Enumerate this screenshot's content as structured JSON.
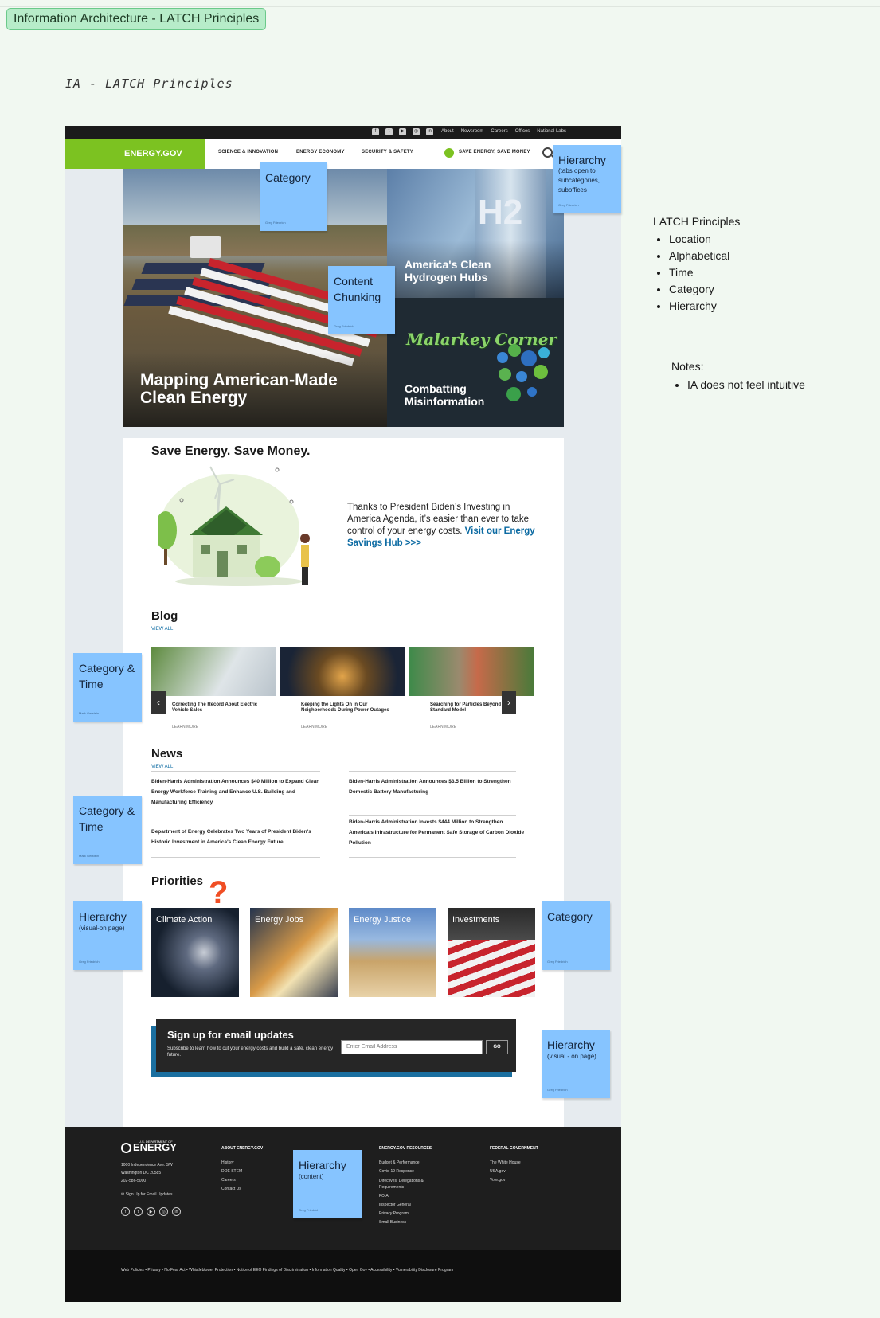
{
  "frame_title": "Information Architecture - LATCH Principles",
  "handwritten_title": "IA - LATCH Principles",
  "site": {
    "utility_links": [
      "About",
      "Newsroom",
      "Careers",
      "Offices",
      "National Labs"
    ],
    "social_icons": [
      "facebook-icon",
      "twitter-icon",
      "youtube-icon",
      "instagram-icon",
      "linkedin-icon"
    ],
    "logo": "ENERGY.GOV",
    "nav": [
      "SCIENCE & INNOVATION",
      "ENERGY ECONOMY",
      "SECURITY & SAFETY",
      "SAVE ENERGY, SAVE MONEY"
    ],
    "brand_green": "#7cc221",
    "hero": {
      "main": "Mapping American-Made Clean Energy",
      "hydrogen": "America's Clean Hydrogen Hubs",
      "h2_graphic": "H2",
      "malarkey_logo": "Malarkey Corner",
      "malarkey": "Combatting Misinformation"
    },
    "save": {
      "title": "Save Energy. Save Money.",
      "text": "Thanks to President Biden’s Investing in America Agenda, it’s easier than ever to take control of your energy costs.",
      "link": "Visit our Energy Savings Hub >>>"
    },
    "blog": {
      "title": "Blog",
      "view_all": "VIEW ALL",
      "more": "LEARN MORE",
      "cards": [
        "Correcting The Record About Electric Vehicle Sales",
        "Keeping the Lights On in Our Neighborhoods During Power Outages",
        "Searching for Particles Beyond the Standard Model"
      ]
    },
    "news": {
      "title": "News",
      "view_all": "VIEW ALL",
      "items": [
        "Biden-Harris Administration Announces $40 Million to Expand Clean Energy Workforce Training and Enhance U.S. Building and Manufacturing Efficiency",
        "Biden-Harris Administration Announces $3.5 Billion to Strengthen Domestic Battery Manufacturing",
        "Department of Energy Celebrates Two Years of President Biden's Historic Investment in America's Clean Energy Future",
        "Biden-Harris Administration Invests $444 Million to Strengthen America's Infrastructure for Permanent Safe Storage of Carbon Dioxide Pollution"
      ]
    },
    "priorities": {
      "title": "Priorities",
      "items": [
        "Climate Action",
        "Energy Jobs",
        "Energy Justice",
        "Investments"
      ]
    },
    "signup": {
      "title": "Sign up for email updates",
      "sub": "Subscribe to learn how to cut your energy costs and build a safe, clean energy future.",
      "placeholder": "Enter Email Address",
      "button": "GO"
    },
    "footer": {
      "dept": "U.S. DEPARTMENT OF",
      "logo": "ENERGY",
      "address": [
        "1000 Independence Ave. SW",
        "Washington DC 20585",
        "202-586-5000"
      ],
      "email_signup": "Sign Up for Email Updates",
      "about_head": "ABOUT ENERGY.GOV",
      "about_links": [
        "History",
        "DOE STEM",
        "Careers",
        "Contact Us"
      ],
      "resources_head": "ENERGY.GOV RESOURCES",
      "resources_links": [
        "Budget & Performance",
        "Covid-19 Response",
        "Directives, Delegations & Requirements",
        "FOIA",
        "Inspector General",
        "Privacy Program",
        "Small Business"
      ],
      "federal_head": "FEDERAL GOVERNMENT",
      "federal_links": [
        "The White House",
        "USA.gov",
        "Vote.gov"
      ],
      "sub_links": "Web Policies  •  Privacy  •  No Fear Act  •  Whistleblower Protection  •  Notice of EEO Findings of Discrimination  •  Information Quality  •  Open Gov  •  Accessibility  •  Vulnerability Disclosure Program"
    }
  },
  "stickies": {
    "category_top": {
      "title": "Category",
      "author": "Greg Friedrich"
    },
    "hierarchy_nav": {
      "title": "Hierarchy",
      "sub": "(tabs open to subcategories, suboffices",
      "author": "Greg Friedrich"
    },
    "content_chunking": {
      "title": "Content Chunking",
      "author": "Greg Friedrich"
    },
    "cat_time_blog": {
      "title": "Category & Time",
      "author": "Mark Gerstein"
    },
    "cat_time_news": {
      "title": "Category & Time",
      "author": "Mark Gerstein"
    },
    "hierarchy_prio": {
      "title": "Hierarchy",
      "sub": "(visual-on page)",
      "author": "Greg Friedrich"
    },
    "category_prio": {
      "title": "Category",
      "author": "Greg Friedrich"
    },
    "hierarchy_signup": {
      "title": "Hierarchy",
      "sub": "(visual - on page)",
      "author": "Greg Friedrich"
    },
    "hierarchy_footer": {
      "title": "Hierarchy",
      "sub": "(content)",
      "author": "Greg Friedrich"
    }
  },
  "question_mark": "?",
  "latch": {
    "title": "LATCH Principles",
    "items": [
      "Location",
      "Alphabetical",
      "Time",
      "Category",
      "Hierarchy"
    ]
  },
  "notes": {
    "title": "Notes:",
    "items": [
      "IA does not feel intuitive"
    ]
  }
}
